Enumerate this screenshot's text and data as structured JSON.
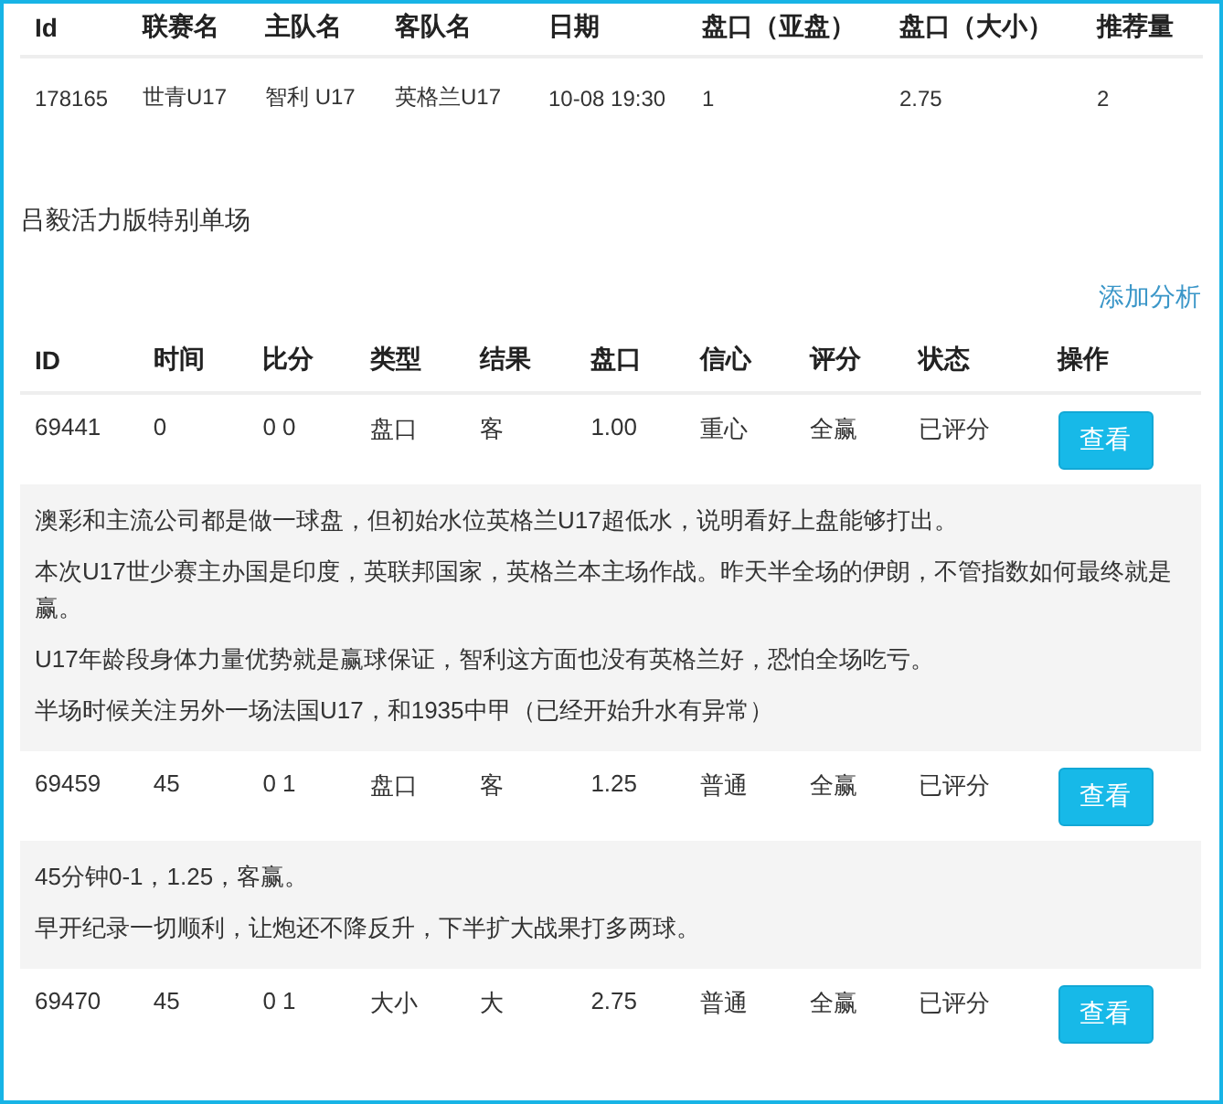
{
  "match_table": {
    "columns": [
      "Id",
      "联赛名",
      "主队名",
      "客队名",
      "日期",
      "盘口（亚盘）",
      "盘口（大小）",
      "推荐量"
    ],
    "rows": [
      [
        "178165",
        "世青U17",
        "智利 U17",
        "英格兰U17",
        "10-08 19:30",
        "1",
        "2.75",
        "2"
      ]
    ]
  },
  "section_title": "吕毅活力版特别单场",
  "add_link": "添加分析",
  "analysis_table": {
    "columns": [
      "ID",
      "时间",
      "比分",
      "类型",
      "结果",
      "盘口",
      "信心",
      "评分",
      "状态",
      "操作"
    ],
    "rows": [
      {
        "cells": [
          "69441",
          "0",
          "0 0",
          "盘口",
          "客",
          "1.00",
          "重心",
          "全赢",
          "已评分"
        ],
        "button": "查看",
        "notes": [
          "澳彩和主流公司都是做一球盘，但初始水位英格兰U17超低水，说明看好上盘能够打出。",
          "本次U17世少赛主办国是印度，英联邦国家，英格兰本主场作战。昨天半全场的伊朗，不管指数如何最终就是赢。",
          "U17年龄段身体力量优势就是赢球保证，智利这方面也没有英格兰好，恐怕全场吃亏。",
          "半场时候关注另外一场法国U17，和1935中甲（已经开始升水有异常）"
        ]
      },
      {
        "cells": [
          "69459",
          "45",
          "0 1",
          "盘口",
          "客",
          "1.25",
          "普通",
          "全赢",
          "已评分"
        ],
        "button": "查看",
        "notes": [
          "45分钟0-1，1.25，客赢。",
          "早开纪录一切顺利，让炮还不降反升，下半扩大战果打多两球。"
        ]
      },
      {
        "cells": [
          "69470",
          "45",
          "0 1",
          "大小",
          "大",
          "2.75",
          "普通",
          "全赢",
          "已评分"
        ],
        "button": "查看"
      }
    ]
  }
}
